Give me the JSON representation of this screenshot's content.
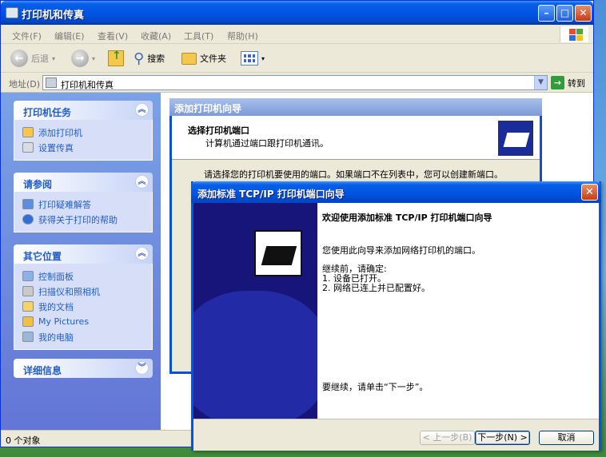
{
  "window": {
    "title": "打印机和传真"
  },
  "menu": [
    "文件(F)",
    "编辑(E)",
    "查看(V)",
    "收藏(A)",
    "工具(T)",
    "帮助(H)"
  ],
  "toolbar": {
    "back": "后退",
    "search": "搜索",
    "folders": "文件夹"
  },
  "address": {
    "label": "地址(D)",
    "value": "打印机和传真",
    "go": "转到"
  },
  "sidebar": {
    "printer_tasks": {
      "title": "打印机任务",
      "items": [
        "添加打印机",
        "设置传真"
      ]
    },
    "see_also": {
      "title": "请参阅",
      "items": [
        "打印疑难解答",
        "获得关于打印的帮助"
      ]
    },
    "other_places": {
      "title": "其它位置",
      "items": [
        "控制面板",
        "扫描仪和照相机",
        "我的文档",
        "My Pictures",
        "我的电脑"
      ]
    },
    "details": {
      "title": "详细信息"
    }
  },
  "bg_wizard": {
    "title": "添加打印机向导",
    "heading": "选择打印机端口",
    "subheading": "计算机通过端口跟打印机通讯。",
    "body": "请选择您的打印机要使用的端口。如果端口不在列表中，您可以创建新端口。"
  },
  "wizard": {
    "title": "添加标准 TCP/IP 打印机端口向导",
    "welcome": "欢迎使用添加标准 TCP/IP 打印机端口向导",
    "intro": "您使用此向导来添加网络打印机的端口。",
    "prereq": "继续前，请确定:",
    "step1": "1.   设备已打开。",
    "step2": "2.   网络已连上并已配置好。",
    "continue": "要继续，请单击“下一步”。",
    "btn_back": "< 上一步(B)",
    "btn_next": "下一步(N) >",
    "btn_cancel": "取消"
  },
  "status": {
    "text": "0 个对象"
  }
}
